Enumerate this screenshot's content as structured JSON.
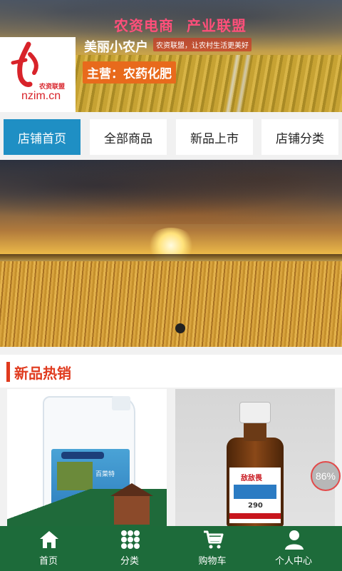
{
  "header": {
    "slogan": "农资电商  产业联盟",
    "shop_name": "美丽小农户",
    "shop_tagline": "农资联盟，让农村生活更美好",
    "main_business": "主营：农药化肥",
    "logo_sub": "农资联盟",
    "logo_url": "nzim.cn"
  },
  "nav": {
    "items": [
      {
        "label": "店铺首页",
        "active": true
      },
      {
        "label": "全部商品",
        "active": false
      },
      {
        "label": "新品上市",
        "active": false
      },
      {
        "label": "店铺分类",
        "active": false
      }
    ]
  },
  "section": {
    "title": "新品热销"
  },
  "products": [
    {
      "label_text": "百菜特"
    },
    {
      "label_text": "敌敌畏",
      "volume": "290"
    }
  ],
  "badge": {
    "progress_text": "86%"
  },
  "tabbar": {
    "items": [
      {
        "label": "首页",
        "icon": "home-icon"
      },
      {
        "label": "分类",
        "icon": "grid-icon"
      },
      {
        "label": "购物车",
        "icon": "cart-icon"
      },
      {
        "label": "个人中心",
        "icon": "user-icon"
      }
    ]
  },
  "colors": {
    "nav_active": "#1f8fc4",
    "section_accent": "#e03a1e",
    "tabbar_bg": "#1d6b3a",
    "main_business_bg": "#e86a1c"
  }
}
